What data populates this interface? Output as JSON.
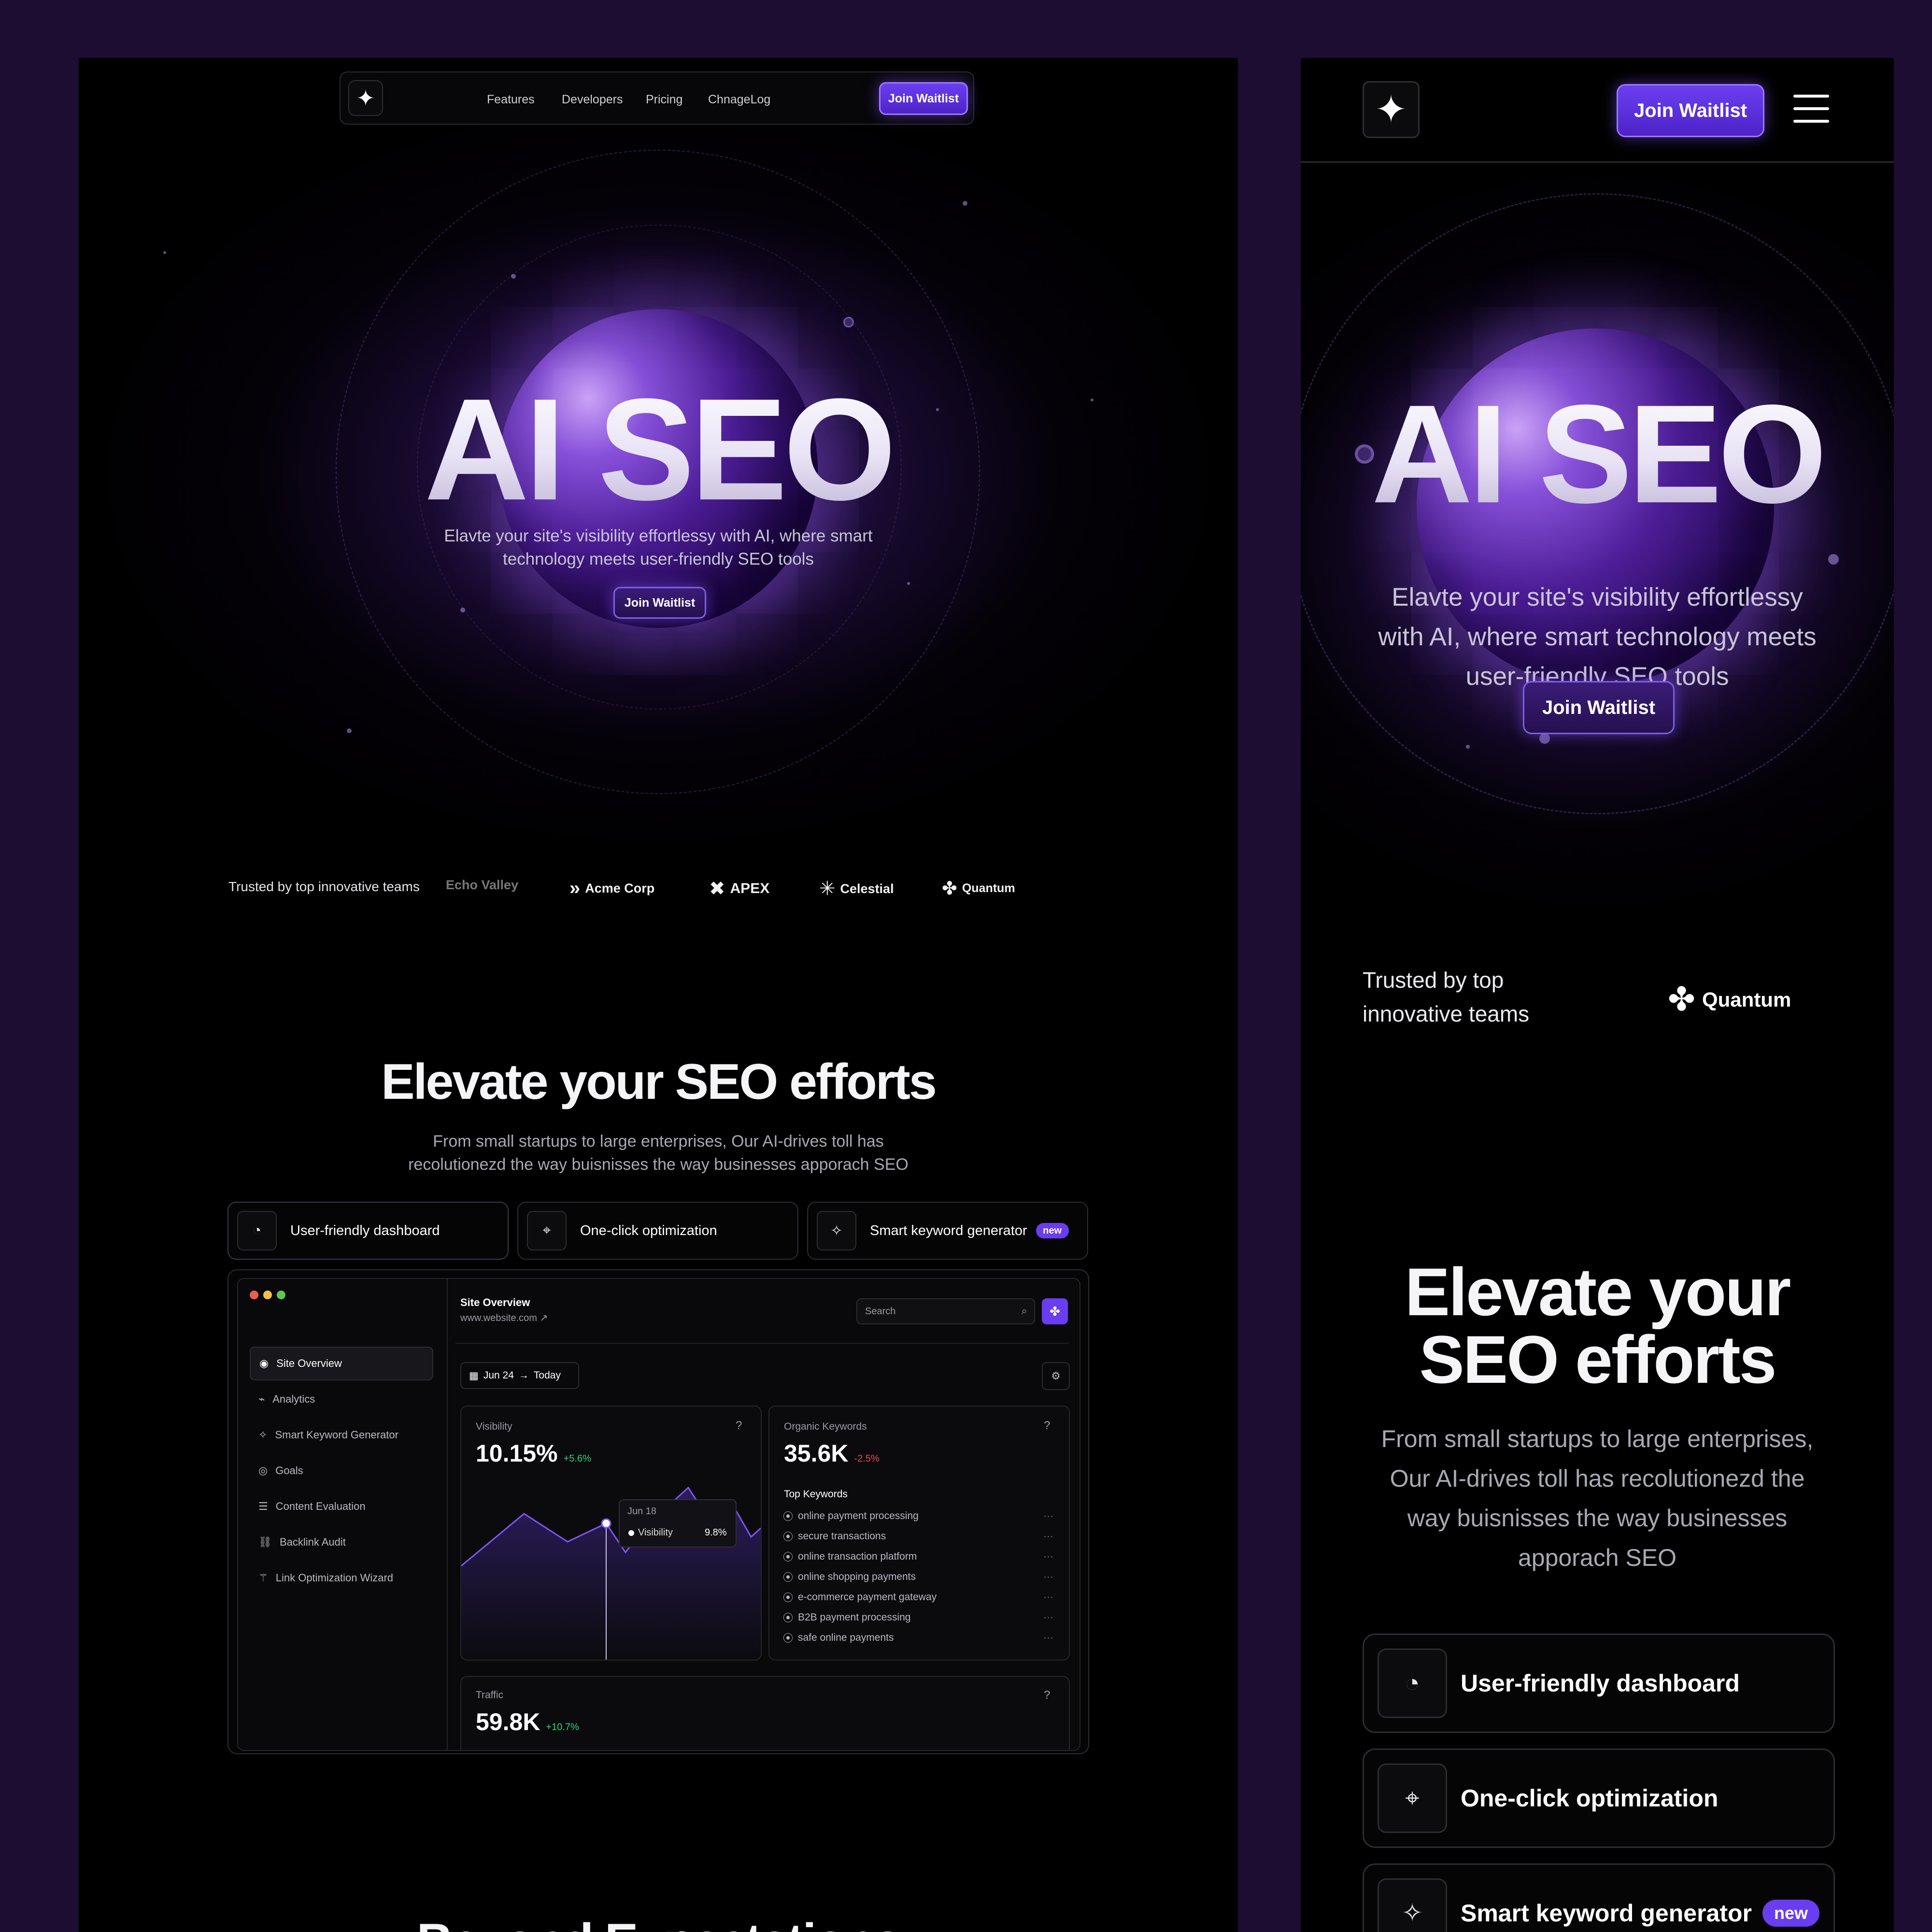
{
  "desktop": {
    "nav": {
      "links": [
        "Features",
        "Developers",
        "Pricing",
        "ChnageLog"
      ],
      "cta": "Join Waitlist"
    },
    "hero": {
      "title": "AI SEO",
      "subtitle_line1": "Elavte your site's visibility effortlessy with AI, where smart",
      "subtitle_line2": "technology meets user-friendly SEO tools",
      "cta": "Join Waitlist"
    },
    "trusted": {
      "label": "Trusted by top innovative teams",
      "brands": [
        "Echo Valley",
        "Acme Corp",
        "APEX",
        "Celestial",
        "Quantum"
      ]
    },
    "section": {
      "title": "Elevate your SEO efforts",
      "subtitle_line1": "From small startups to large enterprises, Our AI-drives toll has",
      "subtitle_line2": "recolutionezd the way buisnisses the way businesses apporach SEO"
    },
    "features": [
      {
        "label": "User-friendly dashboard",
        "icon": "gauge-icon"
      },
      {
        "label": "One-click optimization",
        "icon": "cursor-click-icon"
      },
      {
        "label": "Smart keyword generator",
        "icon": "sparkle-icon",
        "badge": "new"
      }
    ],
    "dashboard": {
      "sidebar": [
        {
          "label": "Site Overview",
          "icon": "eye-icon"
        },
        {
          "label": "Analytics",
          "icon": "chart-icon"
        },
        {
          "label": "Smart Keyword Generator",
          "icon": "sparkle-icon"
        },
        {
          "label": "Goals",
          "icon": "target-icon"
        },
        {
          "label": "Content Evaluation",
          "icon": "list-icon"
        },
        {
          "label": "Backlink Audit",
          "icon": "link-icon"
        },
        {
          "label": "Link Optimization Wizard",
          "icon": "wand-icon"
        }
      ],
      "header_title": "Site Overview",
      "header_url": "www.website.com ↗",
      "search_placeholder": "Search",
      "date_from": "Jun 24",
      "date_to": "Today",
      "visibility": {
        "label": "Visibility",
        "value": "10.15%",
        "delta": "+5.6%"
      },
      "tooltip": {
        "date": "Jun 18",
        "series": "Visibility",
        "value": "9.8%"
      },
      "organic": {
        "label": "Organic Keywords",
        "value": "35.6K",
        "delta": "-2.5%"
      },
      "top_keywords_label": "Top Keywords",
      "keywords": [
        "online payment processing",
        "secure transactions",
        "online transaction platform",
        "online shopping payments",
        "e-commerce payment gateway",
        "B2B payment processing",
        "safe online payments"
      ],
      "traffic": {
        "label": "Traffic",
        "value": "59.8K",
        "delta": "+10.7%"
      }
    },
    "next_section_title": "Beyond Expectations"
  },
  "mobile": {
    "nav_cta": "Join Waitlist",
    "hero": {
      "title": "AI SEO",
      "subtitle_line1": "Elavte your site's visibility effortlessy",
      "subtitle_line2": "with AI, where smart technology meets",
      "subtitle_line3": "user-friendly SEO tools",
      "cta": "Join Waitlist"
    },
    "trusted_line1": "Trusted by top",
    "trusted_line2": "innovative teams",
    "brand": "Quantum",
    "section_title_line1": "Elevate your",
    "section_title_line2": "SEO efforts",
    "section_sub": [
      "From small startups to large enterprises,",
      "Our AI-drives toll has recolutionezd the",
      "way buisnisses the way businesses",
      "apporach SEO"
    ],
    "features": [
      {
        "label": "User-friendly dashboard"
      },
      {
        "label": "One-click optimization"
      },
      {
        "label": "Smart keyword generator",
        "badge": "new"
      }
    ]
  },
  "colors": {
    "page_bg": "#1d0d33",
    "accent": "#6b3ff0",
    "positive": "#2fcf7a",
    "negative": "#e84a5f"
  }
}
